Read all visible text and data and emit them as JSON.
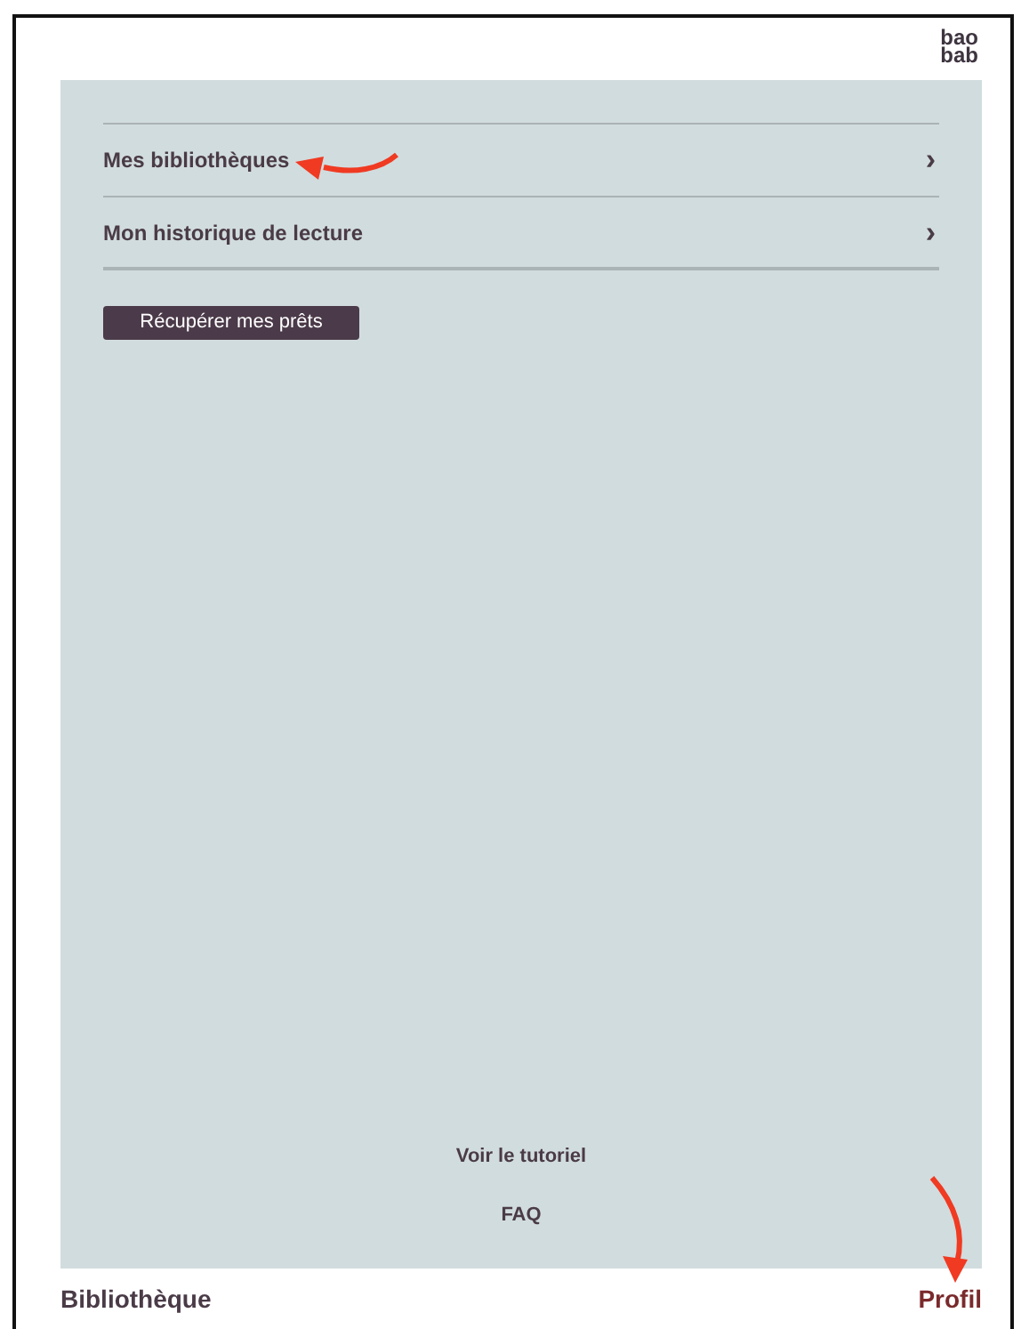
{
  "logo": {
    "line_1": "bao",
    "line_2": "bab"
  },
  "menu": [
    {
      "label": "Mes bibliothèques",
      "chevron": "›"
    },
    {
      "label": "Mon historique de lecture",
      "chevron": "›"
    }
  ],
  "loan_button": "Récupérer mes prêts",
  "footer_links": [
    "Voir le tutoriel",
    "FAQ"
  ],
  "tabs": [
    {
      "label": "Bibliothèque",
      "selected": false
    },
    {
      "label": "Profil",
      "selected": true
    }
  ]
}
